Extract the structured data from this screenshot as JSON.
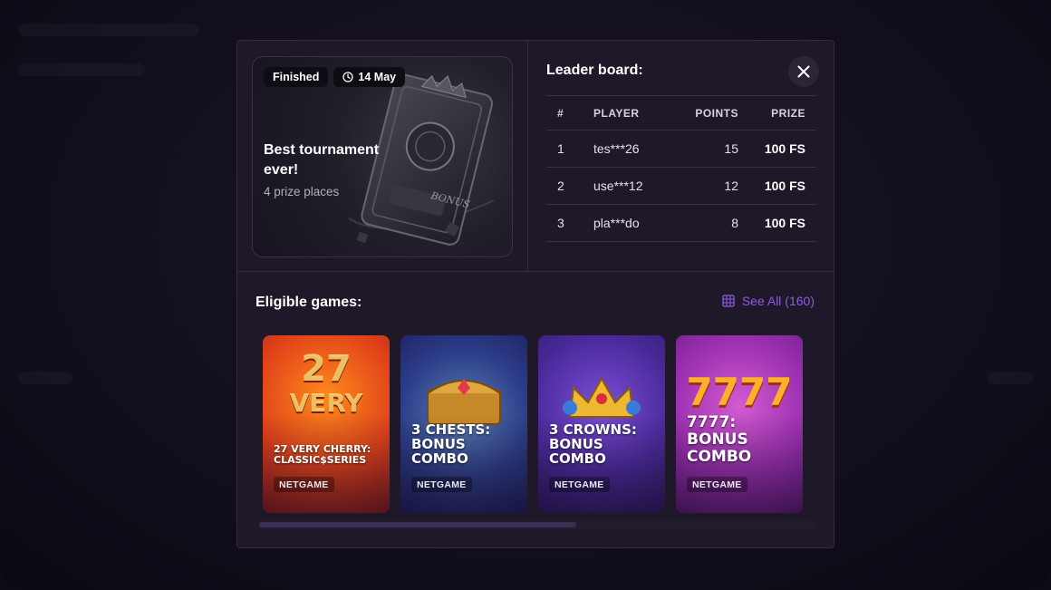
{
  "tournament": {
    "status_badge": "Finished",
    "date_badge": "14 May",
    "title": "Best tournament ever!",
    "subtitle": "4 prize places"
  },
  "leaderboard": {
    "title": "Leader board:",
    "columns": [
      "#",
      "PLAYER",
      "POINTS",
      "PRIZE"
    ],
    "rows": [
      {
        "rank": "1",
        "player": "tes***26",
        "points": "15",
        "prize": "100 FS"
      },
      {
        "rank": "2",
        "player": "use***12",
        "points": "12",
        "prize": "100 FS"
      },
      {
        "rank": "3",
        "player": "pla***do",
        "points": "8",
        "prize": "100 FS"
      }
    ]
  },
  "games_section": {
    "title": "Eligible games:",
    "see_all": "See All (160)"
  },
  "games": [
    {
      "name": "27 Very Cherry: Classic$Series",
      "provider": "NETGAME",
      "art_text": "27"
    },
    {
      "name": "3 Chests: Bonus Combo",
      "provider": "NETGAME",
      "art_text": ""
    },
    {
      "name": "3 Crowns: Bonus Combo",
      "provider": "NETGAME",
      "art_text": ""
    },
    {
      "name": "7777: Bonus Combo",
      "provider": "NETGAME",
      "art_text": "7777"
    }
  ],
  "scrollbar": {
    "visible_fraction": 0.57
  },
  "colors": {
    "accent": "#8f5ae6",
    "modal_bg": "#1e1828",
    "border": "#332b42"
  }
}
